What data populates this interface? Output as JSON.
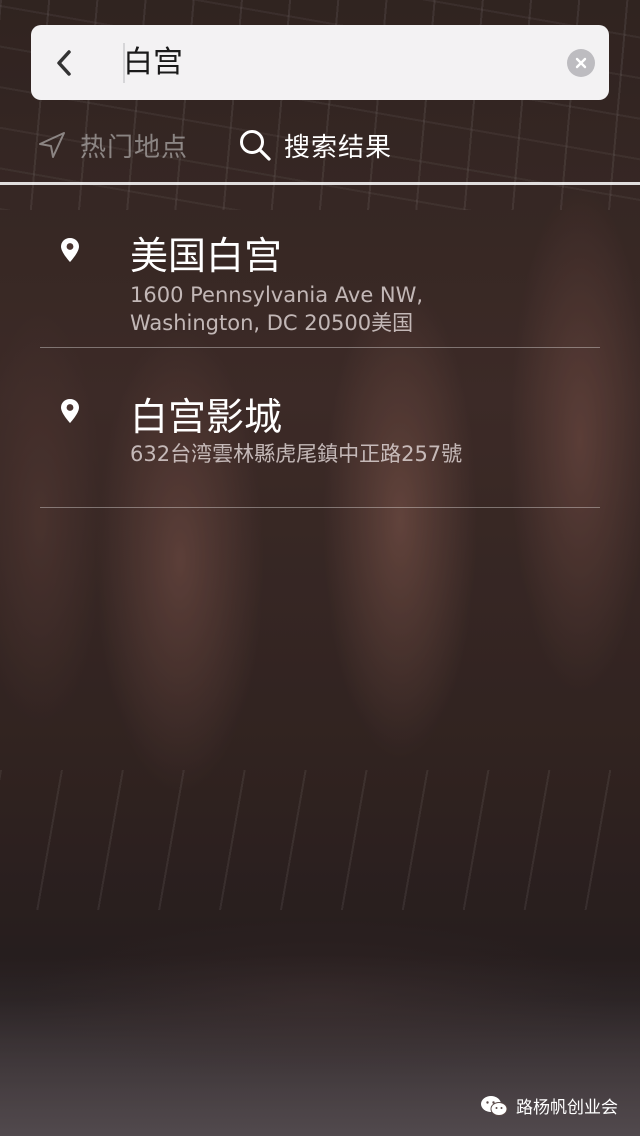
{
  "search": {
    "query": "白宫"
  },
  "tabs": [
    {
      "label": "热门地点",
      "icon": "navigation-arrow-icon",
      "active": false
    },
    {
      "label": "搜索结果",
      "icon": "search-icon",
      "active": true
    }
  ],
  "results": [
    {
      "name": "美国白宫",
      "address_lines": [
        "1600 Pennsylvania Ave NW,",
        "Washington, DC 20500美国"
      ],
      "icon": "location-pin-icon"
    },
    {
      "name": "白宫影城",
      "address_lines": [
        "632台湾雲林縣虎尾鎮中正路257號"
      ],
      "icon": "location-pin-icon"
    }
  ],
  "watermark": {
    "text": "路杨帆创业会",
    "icon": "wechat-icon"
  },
  "colors": {
    "search_bar_bg": "#f3f2f3",
    "active_tab": "#ffffff",
    "inactive_tab": "#d2d2d2",
    "result_title": "#ffffff",
    "clear_button": "#bdbcc0"
  }
}
